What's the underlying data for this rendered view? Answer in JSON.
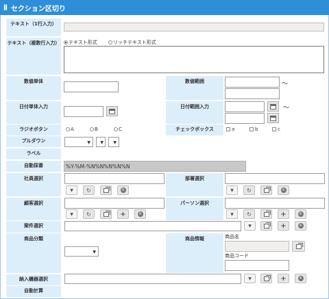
{
  "section": {
    "title": "セクション区切り"
  },
  "fields": {
    "text_single": "テキスト（1行入力）",
    "text_multi": "テキスト（複数行入力）",
    "number_single": "数値単体",
    "number_range": "数値範囲",
    "date_single": "日付単体入力",
    "date_range": "日付範囲入力",
    "radio": "ラジオボタン",
    "checkbox": "チェックボックス",
    "pulldown": "プルダウン",
    "label": "ラベル",
    "auto_number": "自動採番",
    "employee": "社員選択",
    "department": "部署選択",
    "customer": "顧客選択",
    "person": "パーソン選択",
    "project": "案件選択",
    "product_cat": "商品分類",
    "product_info": "商品情報",
    "delivery": "納入機器選択",
    "auto_calc": "自動計算"
  },
  "format": {
    "text": "テキスト形式",
    "rich": "リッチテキスト形式"
  },
  "tilde": "〜",
  "radio_options": [
    "A",
    "B",
    "C"
  ],
  "check_options": [
    "a",
    "b",
    "c"
  ],
  "auto_number_value": "%Y-%M-%N%N%N%N%N",
  "product": {
    "name_label": "商品名",
    "code_label": "商品コード"
  }
}
